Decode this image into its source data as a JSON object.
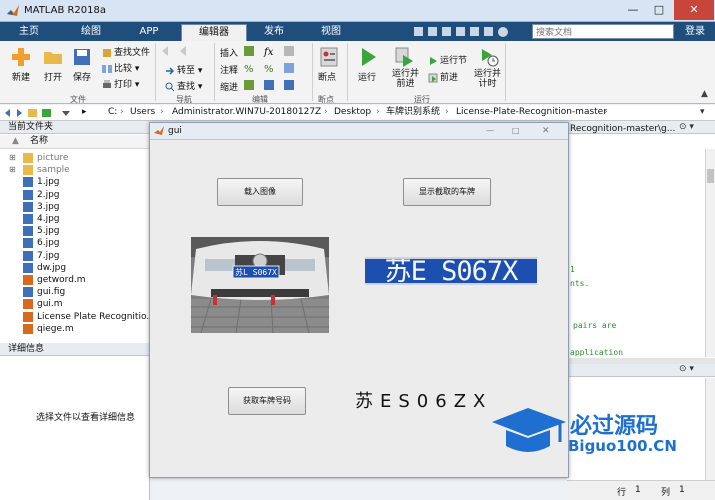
{
  "window": {
    "title": "MATLAB R2018a",
    "min": "—",
    "max": "□",
    "close": "✕"
  },
  "tabs": [
    {
      "label": "主页"
    },
    {
      "label": "绘图"
    },
    {
      "label": "APP"
    },
    {
      "label": "编辑器"
    },
    {
      "label": "发布"
    },
    {
      "label": "视图"
    }
  ],
  "search": {
    "placeholder": "搜索文档"
  },
  "login": "登录",
  "ribbon": {
    "file": {
      "new": "新建",
      "open": "打开",
      "save": "保存",
      "find_files": "查找文件",
      "compare": "比较",
      "print": "打印",
      "group": "文件"
    },
    "nav": {
      "goto": "转至",
      "find": "查找",
      "group": "导航"
    },
    "edit": {
      "insert": "插入",
      "comment": "注释",
      "indent": "缩进",
      "fx": "fx",
      "group": "编辑"
    },
    "breakpoints": {
      "label": "断点",
      "group": "断点"
    },
    "run": {
      "run": "运行",
      "run_advance": "运行并\n前进",
      "run_section": "运行节",
      "advance": "前进",
      "run_time": "运行并\n计时",
      "group": "运行"
    }
  },
  "address": {
    "parts": [
      "C:",
      "Users",
      "Administrator.WIN7U-20180127Z",
      "Desktop",
      "车牌识别系统",
      "License-Plate-Recognition-master"
    ]
  },
  "current_folder": {
    "title": "当前文件夹",
    "col_name": "名称",
    "sort": "▲",
    "items": [
      {
        "name": "picture",
        "type": "folder"
      },
      {
        "name": "sample",
        "type": "folder"
      },
      {
        "name": "1.jpg",
        "type": "img"
      },
      {
        "name": "2.jpg",
        "type": "img"
      },
      {
        "name": "3.jpg",
        "type": "img"
      },
      {
        "name": "4.jpg",
        "type": "img"
      },
      {
        "name": "5.jpg",
        "type": "img"
      },
      {
        "name": "6.jpg",
        "type": "img"
      },
      {
        "name": "7.jpg",
        "type": "img"
      },
      {
        "name": "dw.jpg",
        "type": "img"
      },
      {
        "name": "getword.m",
        "type": "m"
      },
      {
        "name": "gui.fig",
        "type": "fig"
      },
      {
        "name": "gui.m",
        "type": "m"
      },
      {
        "name": "License Plate Recognitio...",
        "type": "m"
      },
      {
        "name": "qiege.m",
        "type": "m"
      }
    ]
  },
  "details": {
    "title": "详细信息",
    "hint": "选择文件以查看详细信息"
  },
  "editor": {
    "path": "Recognition-master\\g...",
    "lines": [
      "1",
      "nts.",
      "pairs are",
      "application"
    ]
  },
  "status": {
    "row_label": "行",
    "row": "1",
    "col_label": "列",
    "col": "1"
  },
  "gui": {
    "title": "gui",
    "btn_load": "载入图像",
    "btn_show_plate": "显示截取的车牌",
    "btn_recognize": "获取车牌号码",
    "plate_image_text": "苏E S067X",
    "car_plate_text": "苏L S067X",
    "result": "苏ES06ZX"
  },
  "watermark": {
    "cn": "必过源码",
    "en": "Biguo100.CN"
  },
  "colors": {
    "ribbon_tab_bar": "#1f4e7d",
    "plate_blue": "#1d4fb0",
    "watermark_blue": "#1e6fcf"
  }
}
